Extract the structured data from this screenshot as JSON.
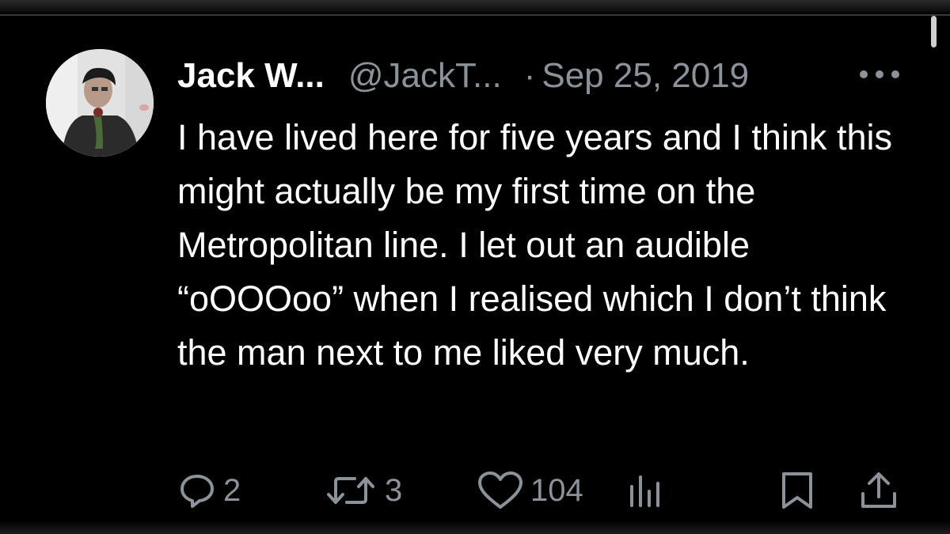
{
  "tweet": {
    "display_name": "Jack W...",
    "handle": "@JackT...",
    "separator": "·",
    "date": "Sep 25, 2019",
    "text": "I have lived here for five years and I think this might actually be my first time on the Metropolitan line. I let out an audible “oOOOoo” when I realised which I don’t think the man next to me liked very much."
  },
  "actions": {
    "replies": "2",
    "retweets": "3",
    "likes": "104"
  },
  "icons": {
    "more": "more-icon",
    "reply": "reply-icon",
    "retweet": "retweet-icon",
    "like": "heart-icon",
    "views": "views-icon",
    "bookmark": "bookmark-icon",
    "share": "share-icon"
  },
  "colors": {
    "background": "#000000",
    "text": "#ffffff",
    "secondary": "#8b9299"
  }
}
